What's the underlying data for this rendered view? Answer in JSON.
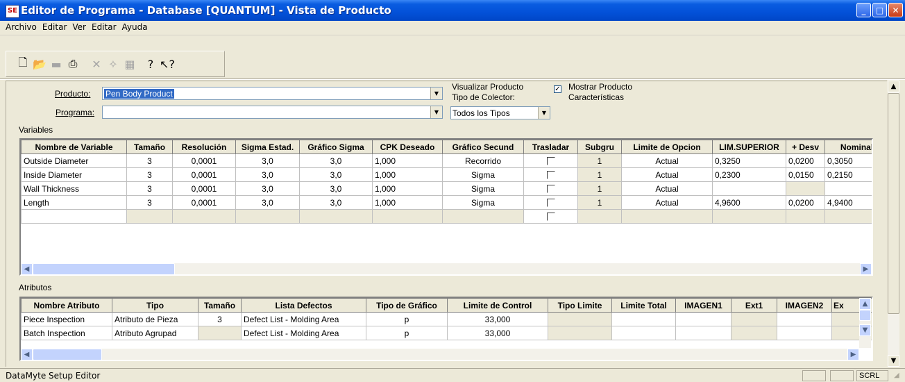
{
  "window": {
    "title": "Editor de Programa - Database [QUANTUM] - Vista de Producto",
    "app_icon_text": "SE"
  },
  "menu": [
    "Archivo",
    "Editar",
    "Ver",
    "Editar",
    "Ayuda"
  ],
  "toolbar_icons": [
    "new-icon",
    "open-icon",
    "save-icon",
    "print-icon",
    "delete-icon",
    "wizard-icon",
    "report-icon",
    "help-icon",
    "context-help-icon"
  ],
  "form": {
    "producto_label": "Producto:",
    "producto_value": "Pen Body Product",
    "programa_label": "Programa:",
    "programa_value": "",
    "visualizar_label_1": "Visualizar Producto",
    "visualizar_label_2": "Tipo de Colector:",
    "tipo_value": "Todos los Tipos",
    "mostrar_label_1": "Mostrar Producto",
    "mostrar_label_2": "Características",
    "mostrar_checked": true
  },
  "variables": {
    "section_label": "Variables",
    "columns": [
      "Nombre de Variable",
      "Tamaño",
      "Resolución",
      "Sigma Estad.",
      "Gráfico Sigma",
      "CPK Deseado",
      "Gráfico Secund",
      "Trasladar",
      "Subgru",
      "Limite de Opcion",
      "LIM.SUPERIOR",
      "+ Desv",
      "Nominal"
    ],
    "rows": [
      [
        "Outside Diameter",
        "3",
        "0,0001",
        "3,0",
        "3,0",
        "1,000",
        "Recorrido",
        "",
        "1",
        "Actual",
        "0,3250",
        "0,0200",
        "0,3050"
      ],
      [
        "Inside Diameter",
        "3",
        "0,0001",
        "3,0",
        "3,0",
        "1,000",
        "Sigma",
        "",
        "1",
        "Actual",
        "0,2300",
        "0,0150",
        "0,2150"
      ],
      [
        "Wall Thickness",
        "3",
        "0,0001",
        "3,0",
        "3,0",
        "1,000",
        "Sigma",
        "",
        "1",
        "Actual",
        "",
        "",
        ""
      ],
      [
        "Length",
        "3",
        "0,0001",
        "3,0",
        "3,0",
        "1,000",
        "Sigma",
        "",
        "1",
        "Actual",
        "4,9600",
        "0,0200",
        "4,9400"
      ],
      [
        "",
        "",
        "",
        "",
        "",
        "",
        "",
        "",
        "",
        "",
        "",
        "",
        ""
      ]
    ]
  },
  "atributos": {
    "section_label": "Atributos",
    "columns": [
      "Nombre Atributo",
      "Tipo",
      "Tamaño",
      "Lista Defectos",
      "Tipo de Gráfico",
      "Limite de Control",
      "Tipo Limite",
      "Limite Total",
      "IMAGEN1",
      "Ext1",
      "IMAGEN2",
      "Ex"
    ],
    "rows": [
      [
        "Piece Inspection",
        "Atributo de Pieza",
        "3",
        "Defect List - Molding Area",
        "p",
        "33,000",
        "",
        "",
        "",
        "",
        "",
        ""
      ],
      [
        "Batch Inspection",
        "Atributo Agrupad",
        "",
        "Defect List - Molding Area",
        "p",
        "33,000",
        "",
        "",
        "",
        "",
        "",
        ""
      ]
    ]
  },
  "status": {
    "text": "DataMyte Setup Editor",
    "scrl": "SCRL"
  }
}
